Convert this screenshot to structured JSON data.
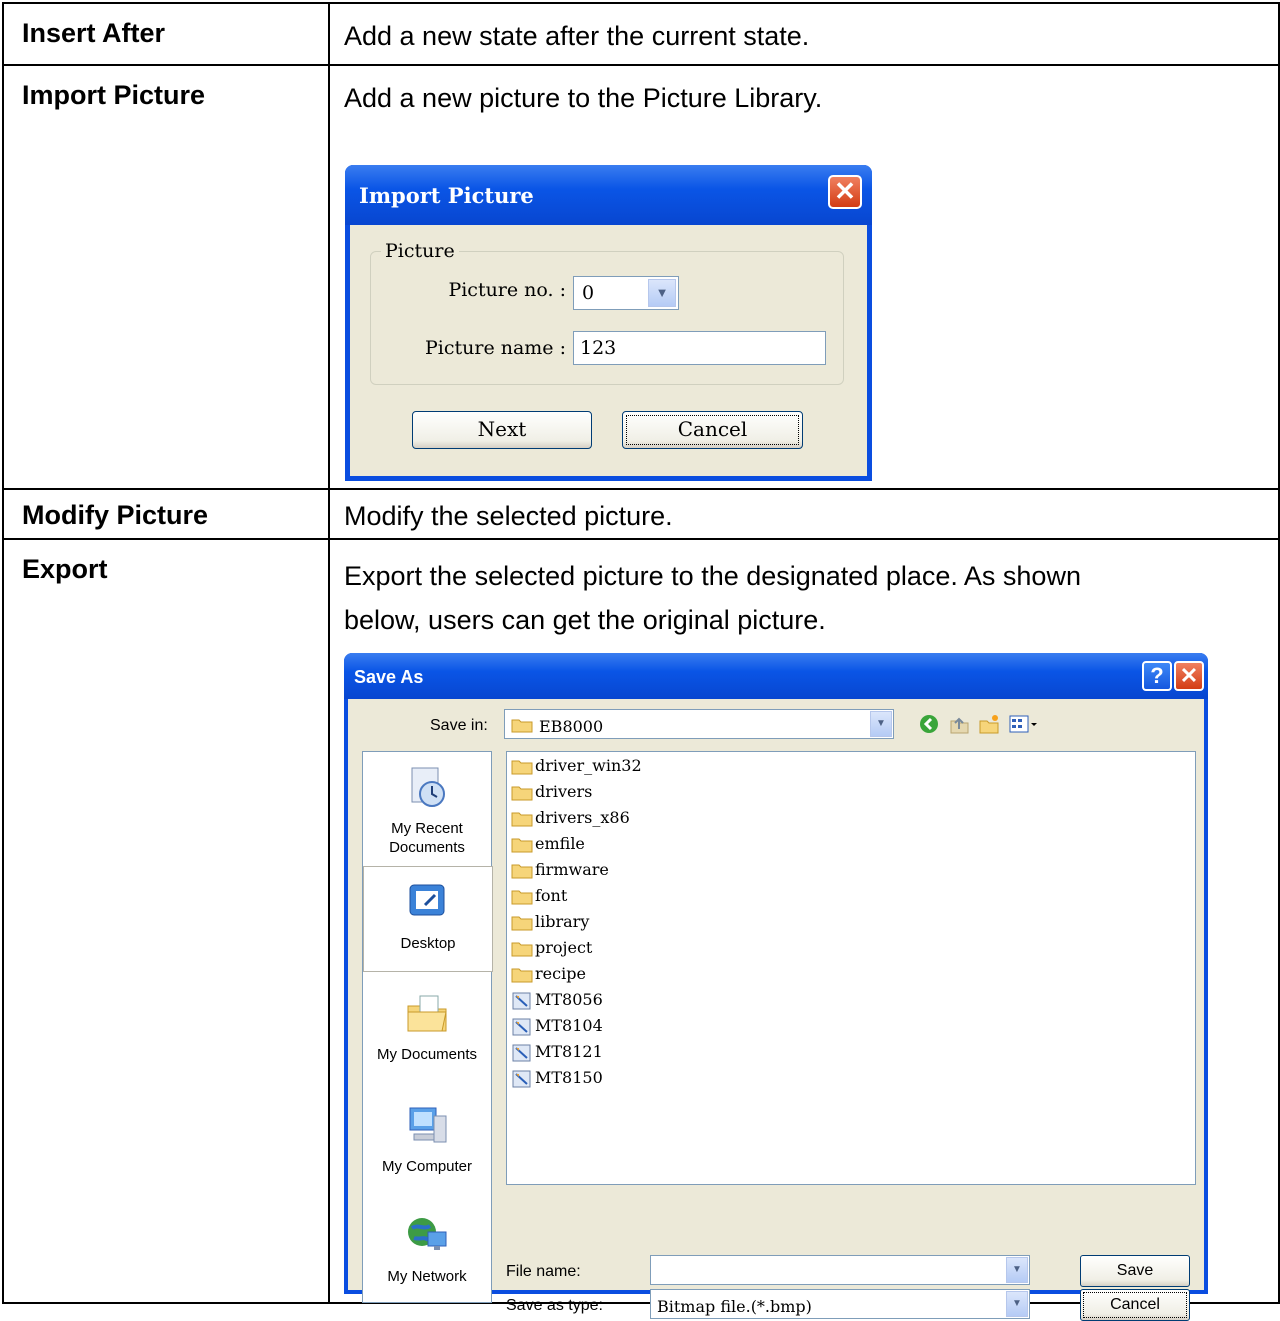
{
  "rows": [
    {
      "term": "Insert After",
      "desc": [
        "Add a new state after the current state."
      ]
    },
    {
      "term": "Import Picture",
      "desc": [
        "Add a new picture to the Picture Library."
      ]
    },
    {
      "term": "Modify Picture",
      "desc": [
        "Modify the selected picture."
      ]
    },
    {
      "term": "Export",
      "desc": [
        "Export the selected picture to the designated place. As shown",
        "below, users can get the original picture."
      ]
    }
  ],
  "import_dialog": {
    "title": "Import Picture",
    "group_label": "Picture",
    "picture_no_label": "Picture no. :",
    "picture_no_value": "0",
    "picture_name_label": "Picture name :",
    "picture_name_value": "123",
    "next_label": "Next",
    "cancel_label": "Cancel"
  },
  "save_dialog": {
    "title": "Save As",
    "help_glyph": "?",
    "close_glyph": "✕",
    "save_in_label": "Save in:",
    "save_in_value": "EB8000",
    "places": [
      "My Recent Documents",
      "Desktop",
      "My Documents",
      "My Computer",
      "My Network"
    ],
    "files": [
      {
        "name": "driver_win32",
        "type": "folder"
      },
      {
        "name": "drivers",
        "type": "folder"
      },
      {
        "name": "drivers_x86",
        "type": "folder"
      },
      {
        "name": "emfile",
        "type": "folder"
      },
      {
        "name": "firmware",
        "type": "folder"
      },
      {
        "name": "font",
        "type": "folder"
      },
      {
        "name": "library",
        "type": "folder"
      },
      {
        "name": "project",
        "type": "folder"
      },
      {
        "name": "recipe",
        "type": "folder"
      },
      {
        "name": "MT8056",
        "type": "file"
      },
      {
        "name": "MT8104",
        "type": "file"
      },
      {
        "name": "MT8121",
        "type": "file"
      },
      {
        "name": "MT8150",
        "type": "file"
      }
    ],
    "file_name_label": "File name:",
    "file_name_value": "",
    "save_type_label": "Save as type:",
    "save_type_value": "Bitmap file.(*.bmp)",
    "save_button": "Save",
    "cancel_button": "Cancel"
  },
  "colors": {
    "xp_title_blue": "#0a55e6",
    "dialog_face": "#ece9d8",
    "close_red": "#d33c14"
  }
}
